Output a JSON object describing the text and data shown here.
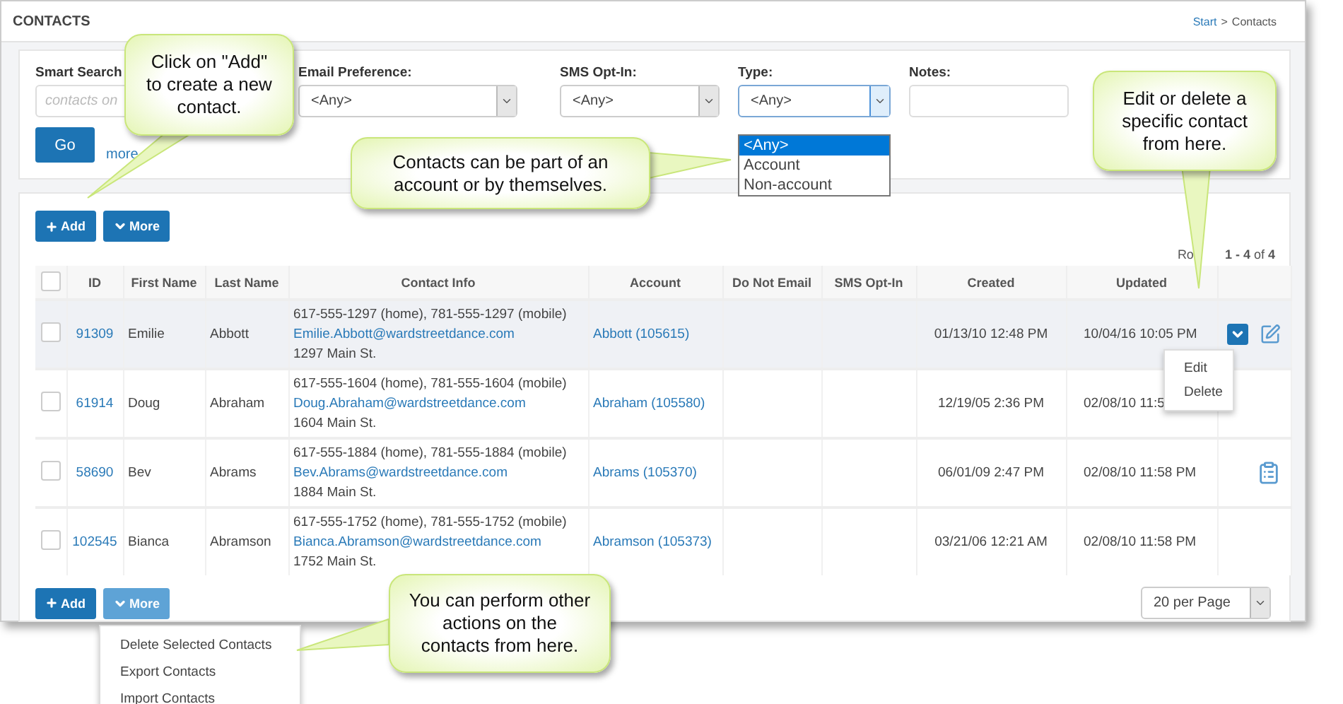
{
  "header": {
    "title": "CONTACTS",
    "breadcrumb": {
      "link": "Start",
      "separator": ">",
      "current": "Contacts"
    }
  },
  "filters": [
    {
      "kind": "search",
      "label": "Smart Search",
      "placeholder": "contacts on"
    },
    {
      "kind": "select",
      "label": "Email Preference:",
      "value": "<Any>",
      "open": false
    },
    {
      "kind": "select",
      "label": "SMS Opt-In:",
      "value": "<Any>",
      "open": false
    },
    {
      "kind": "select",
      "label": "Type:",
      "value": "<Any>",
      "open": true,
      "options": [
        {
          "label": "<Any>",
          "selected": true
        },
        {
          "label": "Account",
          "selected": false
        },
        {
          "label": "Non-account",
          "selected": false
        }
      ]
    },
    {
      "kind": "text",
      "label": "Notes:"
    }
  ],
  "go_button": "Go",
  "more_link": "more",
  "top_toolbar": {
    "add": "Add",
    "more": {
      "label": "More",
      "open": false
    }
  },
  "rows_info": {
    "prefix": "Ro",
    "range": "**1 - 4** of **4**"
  },
  "header_checkbox": {
    "checked": false
  },
  "columns": [
    "ID",
    "First Name",
    "Last Name",
    "Contact Info",
    "Account",
    "Do Not Email",
    "SMS Opt-In",
    "Created",
    "Updated"
  ],
  "rows": [
    {
      "id": "91309",
      "first": "Emilie",
      "last": "Abbott",
      "phones": "617-555-1297 (home), 781-555-1297 (mobile)",
      "email": "Emilie.Abbott@wardstreetdance.com",
      "address": "1297 Main St.",
      "account": "Abbott (105615)",
      "created": "01/13/10 12:48 PM",
      "updated": "10/04/16 10:05 PM",
      "checked": false,
      "hovered": true,
      "has_note": false,
      "menu": [
        "Edit",
        "Delete"
      ]
    },
    {
      "id": "61914",
      "first": "Doug",
      "last": "Abraham",
      "phones": "617-555-1604 (home), 781-555-1604 (mobile)",
      "email": "Doug.Abraham@wardstreetdance.com",
      "address": "1604 Main St.",
      "account": "Abraham (105580)",
      "created": "12/19/05 2:36 PM",
      "updated": "02/08/10 11:5",
      "checked": false,
      "hovered": false,
      "has_note": false
    },
    {
      "id": "58690",
      "first": "Bev",
      "last": "Abrams",
      "phones": "617-555-1884 (home), 781-555-1884 (mobile)",
      "email": "Bev.Abrams@wardstreetdance.com",
      "address": "1884 Main St.",
      "account": "Abrams (105370)",
      "created": "06/01/09 2:47 PM",
      "updated": "02/08/10 11:58 PM",
      "checked": false,
      "hovered": false,
      "has_note": true
    },
    {
      "id": "102545",
      "first": "Bianca",
      "last": "Abramson",
      "phones": "617-555-1752 (home), 781-555-1752 (mobile)",
      "email": "Bianca.Abramson@wardstreetdance.com",
      "address": "1752 Main St.",
      "account": "Abramson (105373)",
      "created": "03/21/06 12:21 AM",
      "updated": "02/08/10 11:58 PM",
      "checked": false,
      "hovered": false,
      "has_note": false
    }
  ],
  "bottom_toolbar": {
    "add": "Add",
    "more": {
      "label": "More",
      "open": true,
      "menu": [
        "Delete Selected Contacts",
        "Export Contacts",
        "Import Contacts"
      ]
    }
  },
  "per_page": "20 per Page",
  "callouts": [
    {
      "text": "Click on \"Add\" to create a new contact."
    },
    {
      "text": "Contacts can be part of an account or by themselves."
    },
    {
      "text": "Edit or delete a specific contact from here."
    },
    {
      "text": "You can perform other actions on the contacts from here."
    }
  ]
}
